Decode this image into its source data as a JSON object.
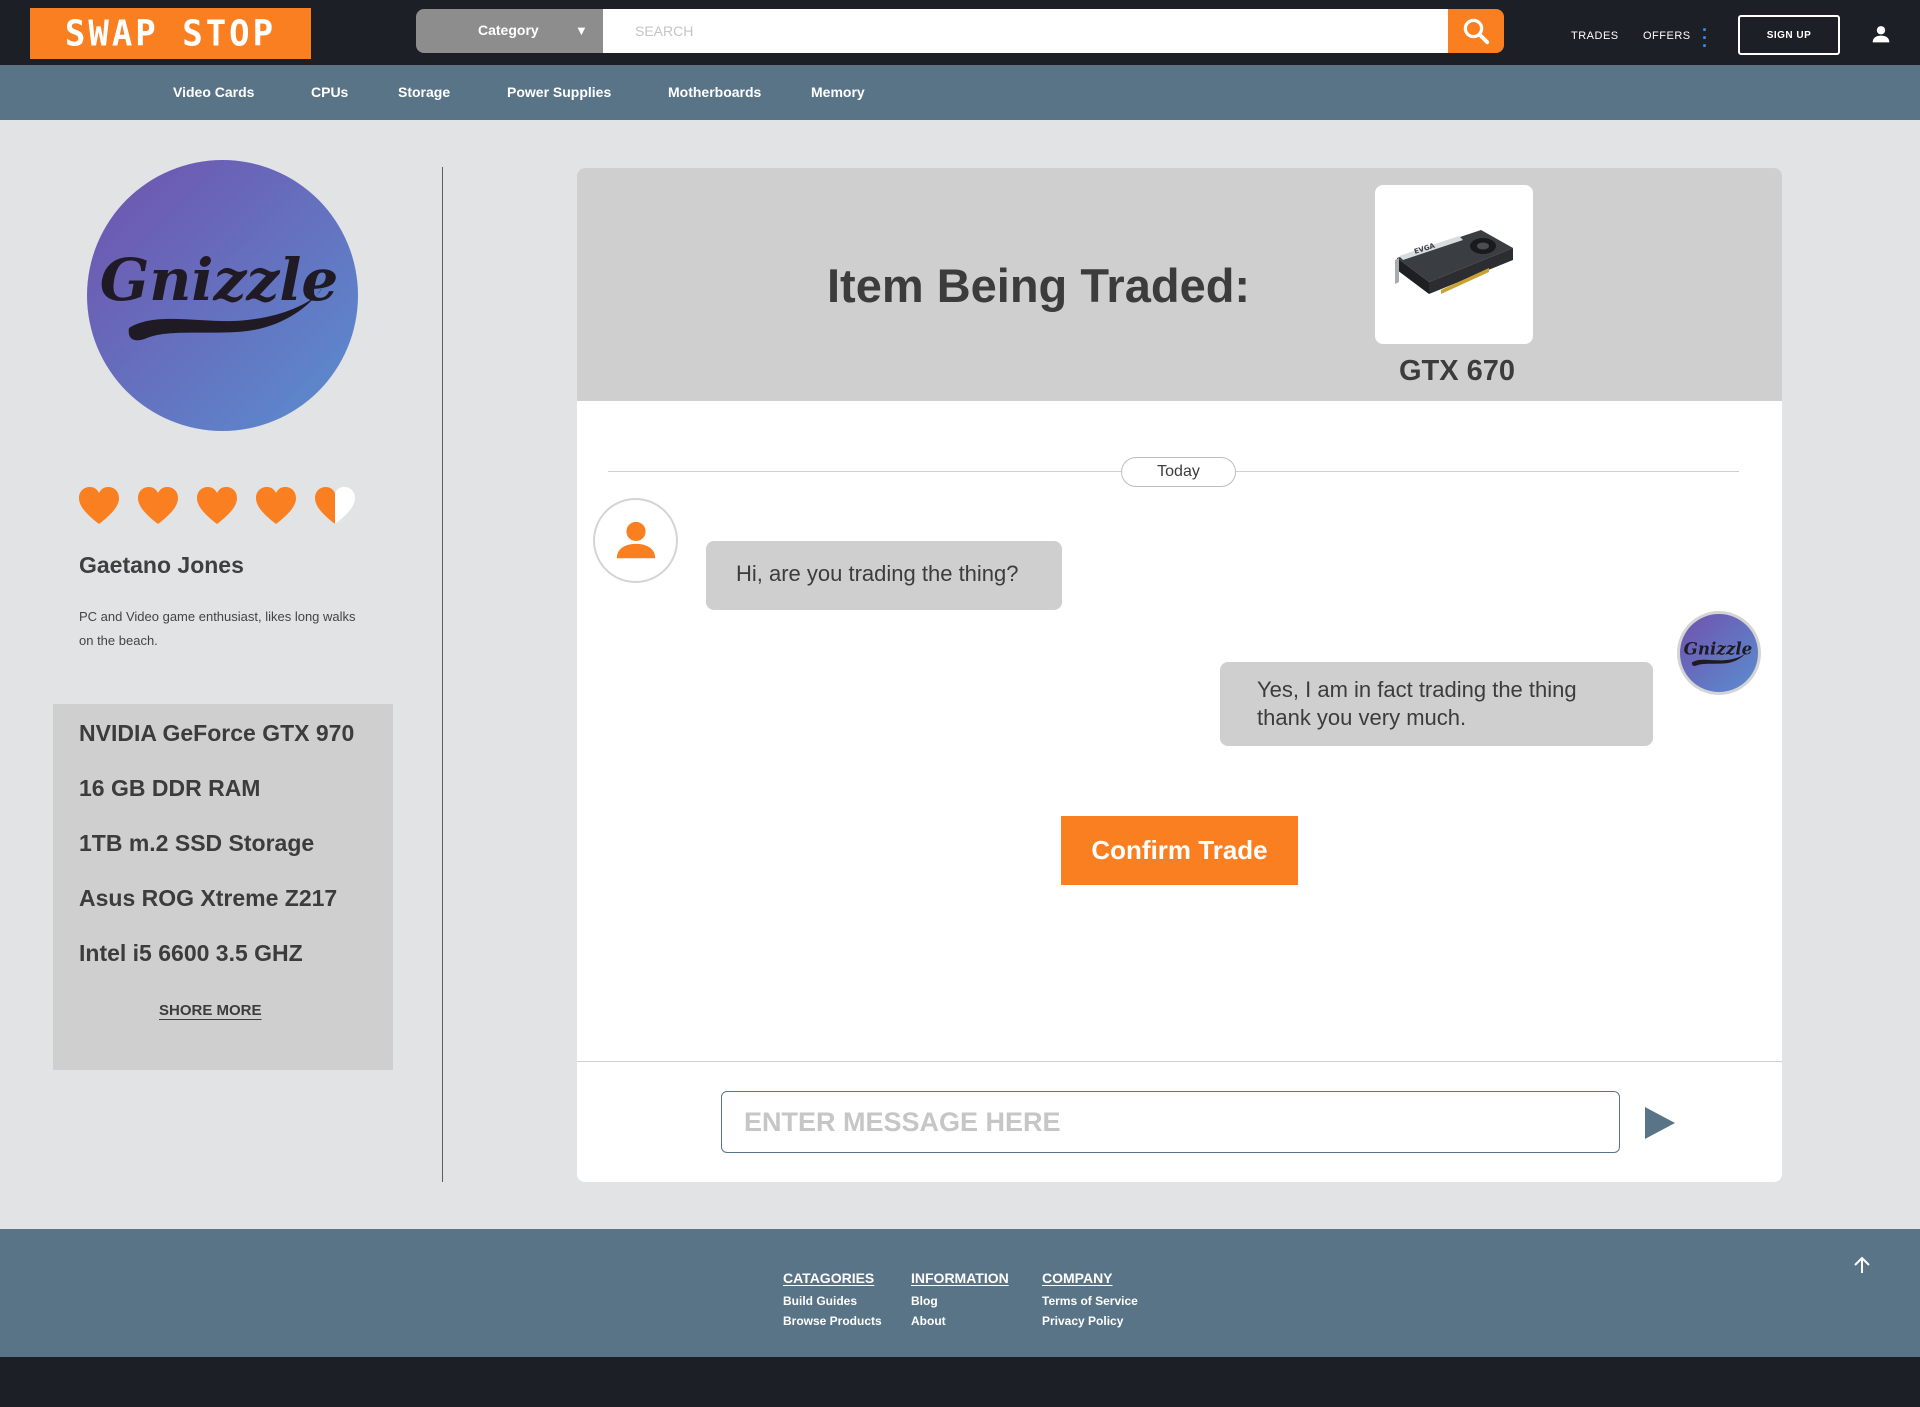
{
  "header": {
    "logo": "SWAP STOP",
    "category_label": "Category",
    "search_placeholder": "SEARCH",
    "nav": {
      "trades": "TRADES",
      "offers": "OFFERS"
    },
    "signup_label": "SIGN UP"
  },
  "category_nav": [
    "Video Cards",
    "CPUs",
    "Storage",
    "Power Supplies",
    "Motherboards",
    "Memory"
  ],
  "profile": {
    "logo_text": "Gnizzle",
    "rating": 4.5,
    "rating_max": 5,
    "name": "Gaetano Jones",
    "bio": "PC and Video game enthusiast, likes long walks on the beach.",
    "specs": [
      "NVIDIA GeForce GTX 970",
      "16 GB DDR RAM",
      "1TB m.2 SSD Storage",
      "Asus ROG Xtreme Z217",
      "Intel i5 6600 3.5 GHZ"
    ],
    "show_more_label": "SHORE MORE"
  },
  "trade": {
    "title": "Item Being Traded:",
    "item_name": "GTX 670",
    "item_brand": "EVGA"
  },
  "chat": {
    "date_label": "Today",
    "messages": [
      {
        "from": "other",
        "text": "Hi, are you trading the thing?"
      },
      {
        "from": "me",
        "text": "Yes, I am in fact trading the thing thank you very much."
      }
    ],
    "confirm_label": "Confirm Trade",
    "input_placeholder": "ENTER MESSAGE HERE"
  },
  "footer": {
    "columns": [
      {
        "heading": "CATAGORIES",
        "links": [
          "Build Guides",
          "Browse Products"
        ]
      },
      {
        "heading": "INFORMATION",
        "links": [
          "Blog",
          "About"
        ]
      },
      {
        "heading": "COMPANY",
        "links": [
          "Terms of Service",
          "Privacy Policy"
        ]
      }
    ]
  },
  "colors": {
    "accent": "#fa7f21",
    "nav_bg": "#5a7487",
    "topbar_bg": "#1c1f25",
    "page_bg": "#e1e3e4",
    "panel_grey": "#cfcfcf"
  },
  "icons": [
    "search-icon",
    "more-vert-icon",
    "user-icon",
    "chevron-down-icon",
    "heart-icon",
    "half-heart-icon",
    "send-icon",
    "arrow-up-icon"
  ]
}
